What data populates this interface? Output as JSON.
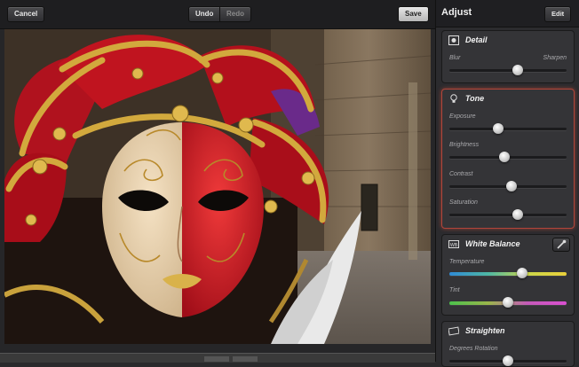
{
  "toolbar": {
    "cancel_label": "Cancel",
    "undo_label": "Undo",
    "redo_label": "Redo",
    "save_label": "Save"
  },
  "panel": {
    "title": "Adjust",
    "edit_label": "Edit",
    "detail": {
      "title": "Detail",
      "left_label": "Blur",
      "right_label": "Sharpen",
      "value": 0.58
    },
    "tone": {
      "title": "Tone",
      "sliders": [
        {
          "label": "Exposure",
          "value": 0.42
        },
        {
          "label": "Brightness",
          "value": 0.47
        },
        {
          "label": "Contrast",
          "value": 0.53
        },
        {
          "label": "Saturation",
          "value": 0.58
        }
      ]
    },
    "white_balance": {
      "title": "White Balance",
      "sliders": [
        {
          "label": "Temperature",
          "value": 0.62
        },
        {
          "label": "Tint",
          "value": 0.5
        }
      ]
    },
    "straighten": {
      "title": "Straighten",
      "label": "Degrees Rotation",
      "value": 0.5
    }
  },
  "colors": {
    "accent_border": "#b2453a",
    "panel_bg": "#2b2b2e",
    "mask_red": "#d4172a",
    "mask_gold": "#c9a23c"
  }
}
